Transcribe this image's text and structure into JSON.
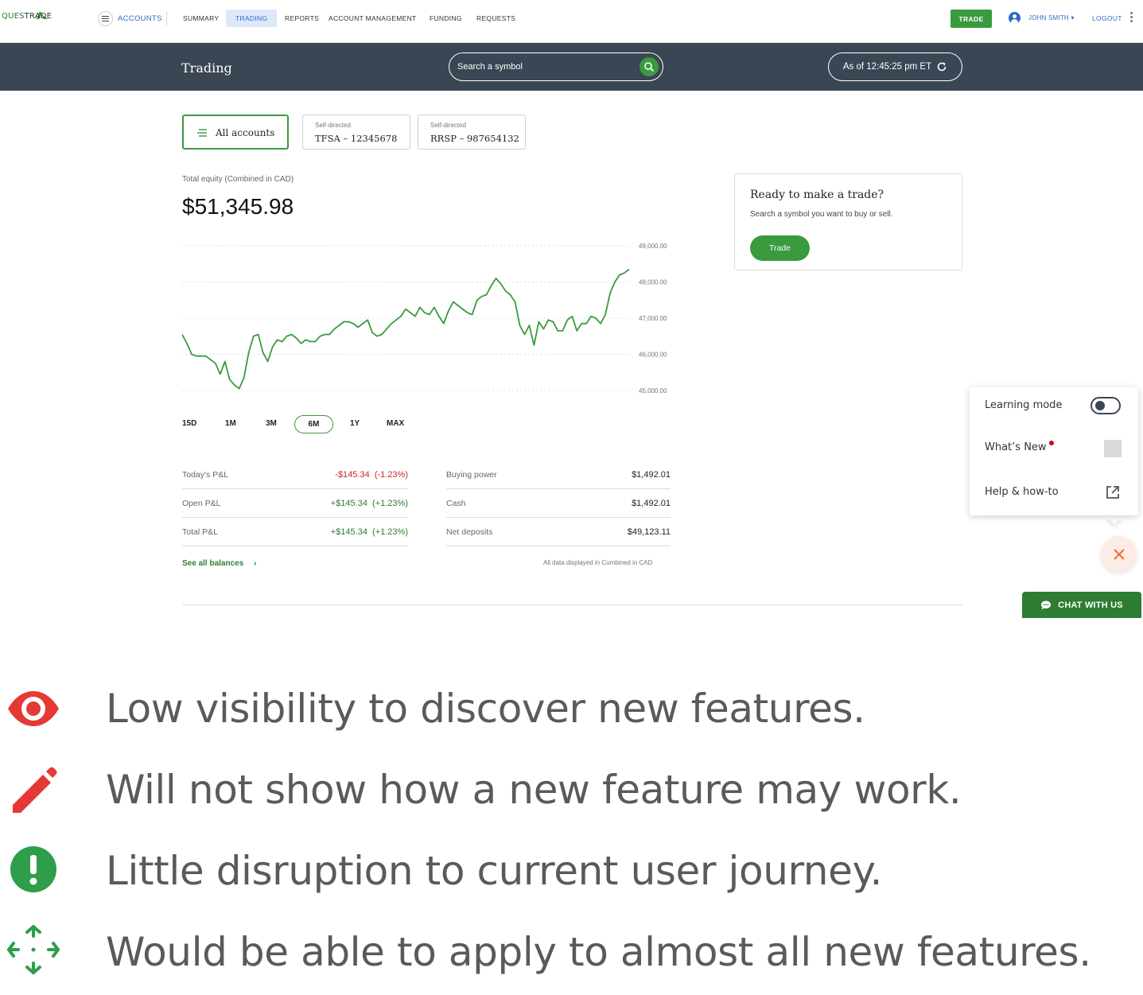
{
  "nav": {
    "logo_text_a": "QUES",
    "logo_text_b": "TRADE",
    "accounts": "ACCOUNTS",
    "items": [
      "SUMMARY",
      "TRADING",
      "REPORTS",
      "ACCOUNT MANAGEMENT",
      "FUNDING",
      "REQUESTS"
    ],
    "active_item": "TRADING",
    "trade_button": "TRADE",
    "user": "JOHN SMITH",
    "logout": "LOGOUT"
  },
  "header": {
    "title": "Trading",
    "search_placeholder": "Search a symbol",
    "as_of": "As of 12:45:25 pm ET"
  },
  "accounts": {
    "all": "All accounts",
    "tfsa": {
      "type": "Self-directed",
      "label": "TFSA – 12345678"
    },
    "rrsp": {
      "type": "Self-directed",
      "label": "RRSP – 987654132"
    }
  },
  "equity": {
    "label": "Total equity (Combined in CAD)",
    "value": "$51,345.98"
  },
  "chart_data": {
    "type": "line",
    "title": "",
    "xlabel": "",
    "ylabel": "",
    "ylim": [
      44800,
      49200
    ],
    "y_ticks": [
      "49,000.00",
      "48,000.00",
      "47,000.00",
      "46,000.00",
      "45,000.00"
    ],
    "y_tick_values": [
      49000,
      48000,
      47000,
      46000,
      45000
    ],
    "grid": true,
    "color": "#3a9a3e",
    "series": [
      {
        "values": [
          46550,
          46300,
          46000,
          45950,
          45950,
          45950,
          45850,
          45750,
          45450,
          45800,
          45300,
          45150,
          45050,
          45350,
          46050,
          46500,
          46550,
          46050,
          45800,
          46200,
          46400,
          46350,
          46500,
          46550,
          46450,
          46300,
          46400,
          46350,
          46350,
          46500,
          46550,
          46550,
          46700,
          46800,
          46900,
          46900,
          46850,
          46750,
          46850,
          46950,
          46600,
          46500,
          46550,
          46700,
          46850,
          46950,
          47050,
          47250,
          47150,
          47050,
          47300,
          47150,
          47100,
          47300,
          47050,
          46850,
          47200,
          47450,
          47350,
          47250,
          47150,
          47100,
          47500,
          47600,
          47650,
          47900,
          48100,
          47950,
          47750,
          47650,
          47450,
          46800,
          46550,
          46800,
          46250,
          46900,
          46700,
          46950,
          46900,
          46650,
          46650,
          46950,
          47050,
          46650,
          46850,
          46850,
          47050,
          47000,
          46850,
          47100,
          47700,
          48000,
          48200,
          48250,
          48350
        ]
      }
    ]
  },
  "periods": [
    "15D",
    "1M",
    "3M",
    "6M",
    "1Y",
    "MAX"
  ],
  "active_period": "6M",
  "balances": {
    "left": [
      {
        "k": "Today's P&L",
        "v": "-$145.34  (-1.23%)",
        "tone": "neg"
      },
      {
        "k": "Open P&L",
        "v": "+$145.34  (+1.23%)",
        "tone": "pos"
      },
      {
        "k": "Total P&L",
        "v": "+$145.34  (+1.23%)",
        "tone": "pos"
      }
    ],
    "right": [
      {
        "k": "Buying power",
        "v": "$1,492.01"
      },
      {
        "k": "Cash",
        "v": "$1,492.01"
      },
      {
        "k": "Net deposits",
        "v": "$49,123.11"
      }
    ],
    "see_all": "See all balances",
    "note": "All data displayed in Combined in CAD"
  },
  "trade_card": {
    "title": "Ready to make a trade?",
    "subtitle": "Search a symbol you want to buy or sell.",
    "button": "Trade"
  },
  "learning_panel": {
    "learning_mode": "Learning mode",
    "whats_new": "What’s New",
    "help": "Help & how-to"
  },
  "chat": "CHAT WITH US",
  "notes": [
    {
      "icon": "eye-icon",
      "color": "#e53935",
      "text": "Low visibility to discover new features."
    },
    {
      "icon": "pencil-icon",
      "color": "#e53935",
      "text": "Will not show how a new feature may work."
    },
    {
      "icon": "exclamation-icon",
      "color": "#2e9e4a",
      "text": "Little disruption to current user journey."
    },
    {
      "icon": "move-arrows-icon",
      "color": "#2e9e4a",
      "text": "Would be able to apply to almost all new features."
    }
  ]
}
